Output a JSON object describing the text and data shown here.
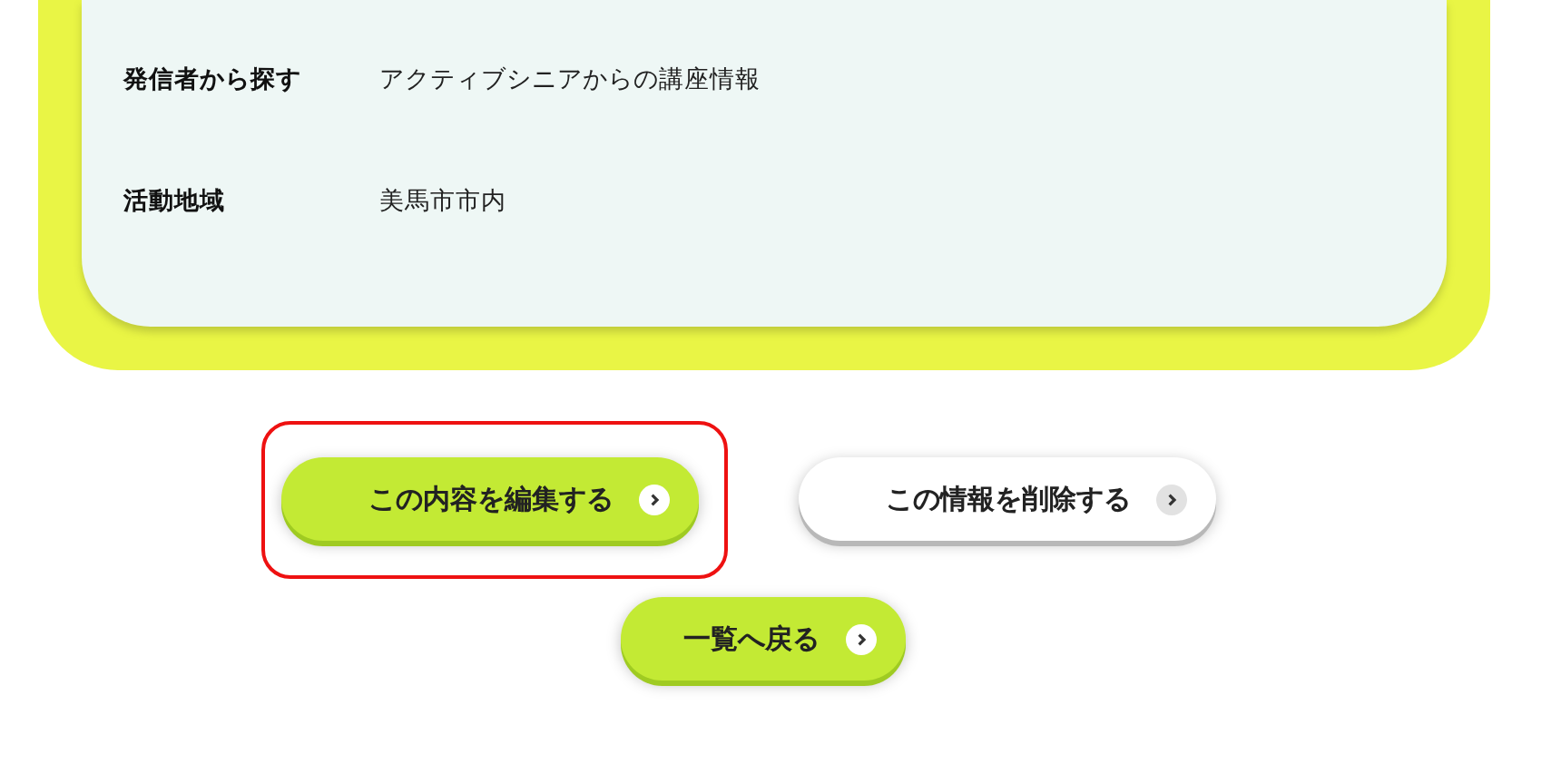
{
  "details": [
    {
      "label": "発信者から探す",
      "value": "アクティブシニアからの講座情報"
    },
    {
      "label": "活動地域",
      "value": "美馬市市内"
    }
  ],
  "actions": [
    {
      "label": "この内容を編集する",
      "kind": "primary",
      "highlighted": true
    },
    {
      "label": "この情報を削除する",
      "kind": "secondary",
      "highlighted": false
    }
  ],
  "back_button": {
    "label": "一覧へ戻る",
    "kind": "primary"
  }
}
